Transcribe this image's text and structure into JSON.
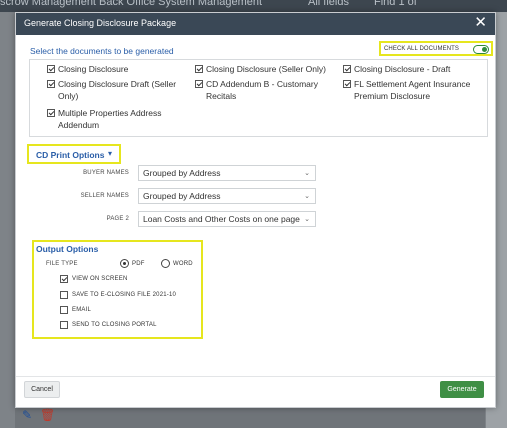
{
  "background": {
    "menu_text": "scrow Management  Back Office  System Management",
    "tab_left": "All fields",
    "tab_right": "Find 1 of"
  },
  "modal": {
    "title": "Generate Closing Disclosure Package",
    "close_glyph": "✕"
  },
  "documents": {
    "section_label": "Select the documents to be generated",
    "check_all_label": "CHECK ALL DOCUMENTS",
    "check_all_on": true,
    "items": [
      {
        "label": "Closing Disclosure",
        "checked": true
      },
      {
        "label": "Closing Disclosure (Seller Only)",
        "checked": true
      },
      {
        "label": "Closing Disclosure - Draft",
        "checked": true
      },
      {
        "label": "Closing Disclosure Draft (Seller Only)",
        "checked": true
      },
      {
        "label": "CD Addendum B - Customary Recitals",
        "checked": true
      },
      {
        "label": "FL Settlement Agent Insurance Premium Disclosure",
        "checked": true
      },
      {
        "label": "Multiple Properties Address Addendum",
        "checked": true
      }
    ]
  },
  "print_options": {
    "label": "CD Print Options",
    "chevron_icon": "chevron-down-icon",
    "buyer_names_label": "BUYER NAMES",
    "buyer_names_value": "Grouped by Address",
    "seller_names_label": "SELLER NAMES",
    "seller_names_value": "Grouped by Address",
    "page2_label": "PAGE 2",
    "page2_value": "Loan Costs and Other Costs on one page"
  },
  "output": {
    "title": "Output Options",
    "file_type_label": "FILE TYPE",
    "pdf_label": "PDF",
    "word_label": "WORD",
    "selected_type": "PDF",
    "options": [
      {
        "label": "VIEW ON SCREEN",
        "checked": true
      },
      {
        "label": "SAVE TO E-CLOSING FILE 2021-10",
        "checked": false
      },
      {
        "label": "EMAIL",
        "checked": false
      },
      {
        "label": "SEND TO CLOSING PORTAL",
        "checked": false
      }
    ]
  },
  "footer": {
    "cancel_label": "Cancel",
    "generate_label": "Generate"
  },
  "colors": {
    "header_bg": "#3a4856",
    "accent_blue": "#2a5ea8",
    "highlight_yellow": "#e6e61e",
    "generate_green": "#3f8f45"
  }
}
